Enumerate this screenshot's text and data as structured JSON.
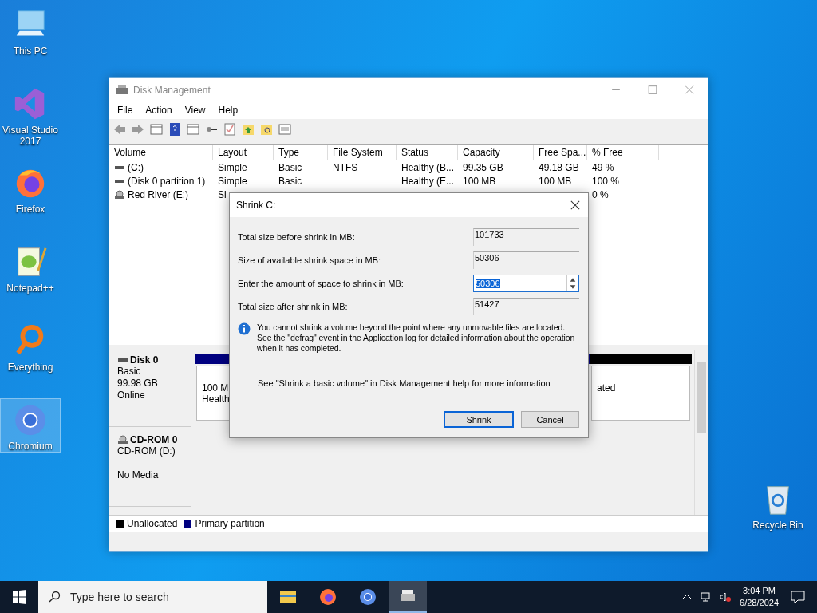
{
  "desktop_icons": [
    {
      "kind": "pc",
      "label": "This PC",
      "selected": false
    },
    {
      "kind": "vs",
      "label": "Visual Studio 2017",
      "selected": false
    },
    {
      "kind": "firefox",
      "label": "Firefox",
      "selected": false
    },
    {
      "kind": "notepad",
      "label": "Notepad++",
      "selected": false
    },
    {
      "kind": "everything",
      "label": "Everything",
      "selected": false
    },
    {
      "kind": "chromium",
      "label": "Chromium",
      "selected": true
    }
  ],
  "recycle_bin": {
    "label": "Recycle Bin"
  },
  "window": {
    "title": "Disk Management",
    "menu": [
      "File",
      "Action",
      "View",
      "Help"
    ],
    "toolbar": [
      {
        "kind": "back"
      },
      {
        "kind": "forward"
      },
      {
        "kind": "list"
      },
      {
        "kind": "help"
      },
      {
        "kind": "list"
      },
      {
        "kind": "key"
      },
      {
        "kind": "check"
      },
      {
        "kind": "up"
      },
      {
        "kind": "find"
      },
      {
        "kind": "props"
      }
    ],
    "columns": [
      "Volume",
      "Layout",
      "Type",
      "File System",
      "Status",
      "Capacity",
      "Free Spa...",
      "% Free"
    ],
    "rows": [
      {
        "kind": "disk",
        "cells": [
          "(C:)",
          "Simple",
          "Basic",
          "NTFS",
          "Healthy (B...",
          "99.35 GB",
          "49.18 GB",
          "49 %"
        ]
      },
      {
        "kind": "disk",
        "cells": [
          "(Disk 0 partition 1)",
          "Simple",
          "Basic",
          null,
          "Healthy (E...",
          "100 MB",
          "100 MB",
          "100 %"
        ]
      },
      {
        "kind": "cd",
        "cells": [
          "Red River (E:)",
          "Si",
          null,
          null,
          null,
          null,
          null,
          "0 %"
        ]
      }
    ],
    "disks": [
      {
        "kind": "disk",
        "name": "Disk 0",
        "lines": [
          "Basic",
          "99.98 GB",
          "Online"
        ],
        "partitions": [
          {
            "color": "#000080",
            "lines": [
              "100 M",
              "Health"
            ]
          },
          {
            "color": "#000000",
            "lines": [
              "ated"
            ]
          }
        ]
      },
      {
        "kind": "cd",
        "name": "CD-ROM 0",
        "lines": [
          "CD-ROM (D:)",
          "No Media"
        ]
      }
    ],
    "legend": [
      {
        "label": "Unallocated",
        "color": "#000000"
      },
      {
        "label": "Primary partition",
        "color": "#000080"
      }
    ]
  },
  "dialog": {
    "title": "Shrink C:",
    "fields": [
      {
        "kind": "readonly",
        "label": "Total size before shrink in MB:",
        "value": "101733"
      },
      {
        "kind": "readonly",
        "label": "Size of available shrink space in MB:",
        "value": "50306"
      },
      {
        "kind": "spin",
        "label": "Enter the amount of space to shrink in MB:",
        "value": "50306"
      },
      {
        "kind": "readonly",
        "label": "Total size after shrink in MB:",
        "value": "51427"
      }
    ],
    "info": "You cannot shrink a volume beyond the point where any unmovable files are located. See the \"defrag\" event in the Application log for detailed information about the operation when it has completed.",
    "help": "See \"Shrink a basic volume\" in Disk Management help for more information",
    "buttons": [
      {
        "label": "Shrink",
        "default": true
      },
      {
        "label": "Cancel",
        "default": false
      }
    ]
  },
  "taskbar": {
    "search": {
      "placeholder": "Type here to search"
    },
    "apps": [
      {
        "kind": "explorer",
        "active": false
      },
      {
        "kind": "firefox",
        "active": false
      },
      {
        "kind": "chromium",
        "active": false
      },
      {
        "kind": "diskmgmt",
        "active": true
      }
    ],
    "time": "3:04 PM",
    "date": "6/28/2024"
  }
}
